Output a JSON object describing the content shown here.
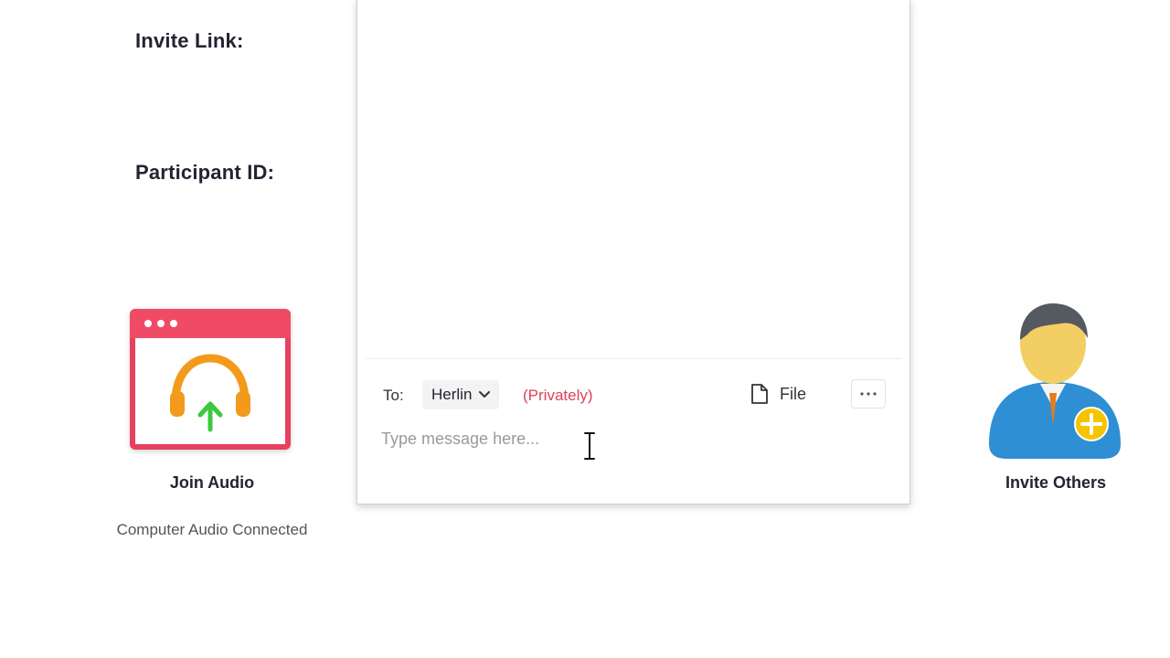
{
  "info": {
    "invite_link_label": "Invite Link:",
    "participant_id_label": "Participant ID:"
  },
  "join_audio": {
    "label": "Join Audio",
    "status": "Computer Audio Connected",
    "icon": "headphones-upload-icon"
  },
  "chat": {
    "to_label": "To:",
    "recipient": "Herlin",
    "privacy_note": "(Privately)",
    "file_label": "File",
    "more_icon": "ellipsis-icon",
    "input_value": "",
    "input_placeholder": "Type message here..."
  },
  "invite_others": {
    "label": "Invite Others",
    "icon": "add-user-icon"
  },
  "colors": {
    "privately": "#e0405a",
    "audio_card": "#ef4b67",
    "headphones": "#f29a1c",
    "upload_arrow": "#3cc83c",
    "user_body": "#2e8fd4",
    "add_badge": "#f5c400"
  }
}
